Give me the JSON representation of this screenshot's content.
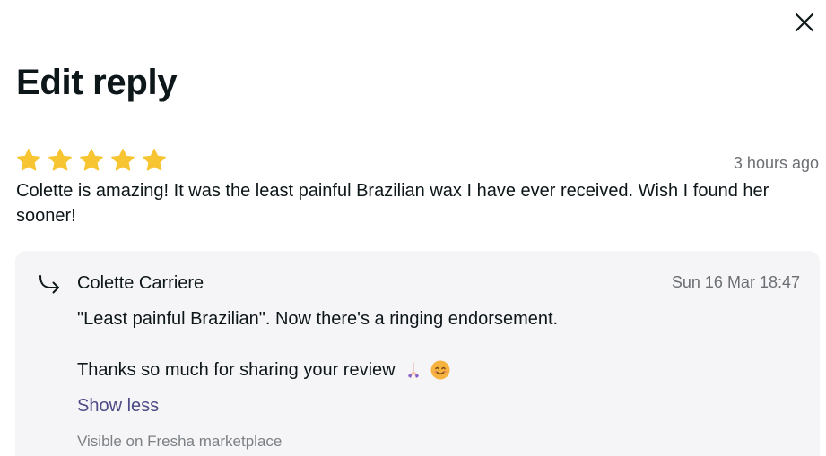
{
  "dialog": {
    "title": "Edit reply",
    "close_icon": "close-icon"
  },
  "review": {
    "rating": 5,
    "rating_max": 5,
    "star_color": "#f7c531",
    "time": "3 hours ago",
    "text": "Colette is amazing! It was the least painful Brazilian wax I have ever received. Wish I found her sooner!"
  },
  "reply": {
    "icon": "reply-arrow-icon",
    "author": "Colette Carriere",
    "date": "Sun 16 Mar 18:47",
    "line1": "\"Least painful Brazilian\". Now there's a ringing endorsement.",
    "line2": "Thanks so much for sharing your review",
    "emojis": [
      "praying-hands-icon",
      "smiling-face-icon"
    ],
    "show_less_label": "Show less",
    "show_less_color": "#4d4a86",
    "visibility": "Visible on Fresha marketplace"
  }
}
